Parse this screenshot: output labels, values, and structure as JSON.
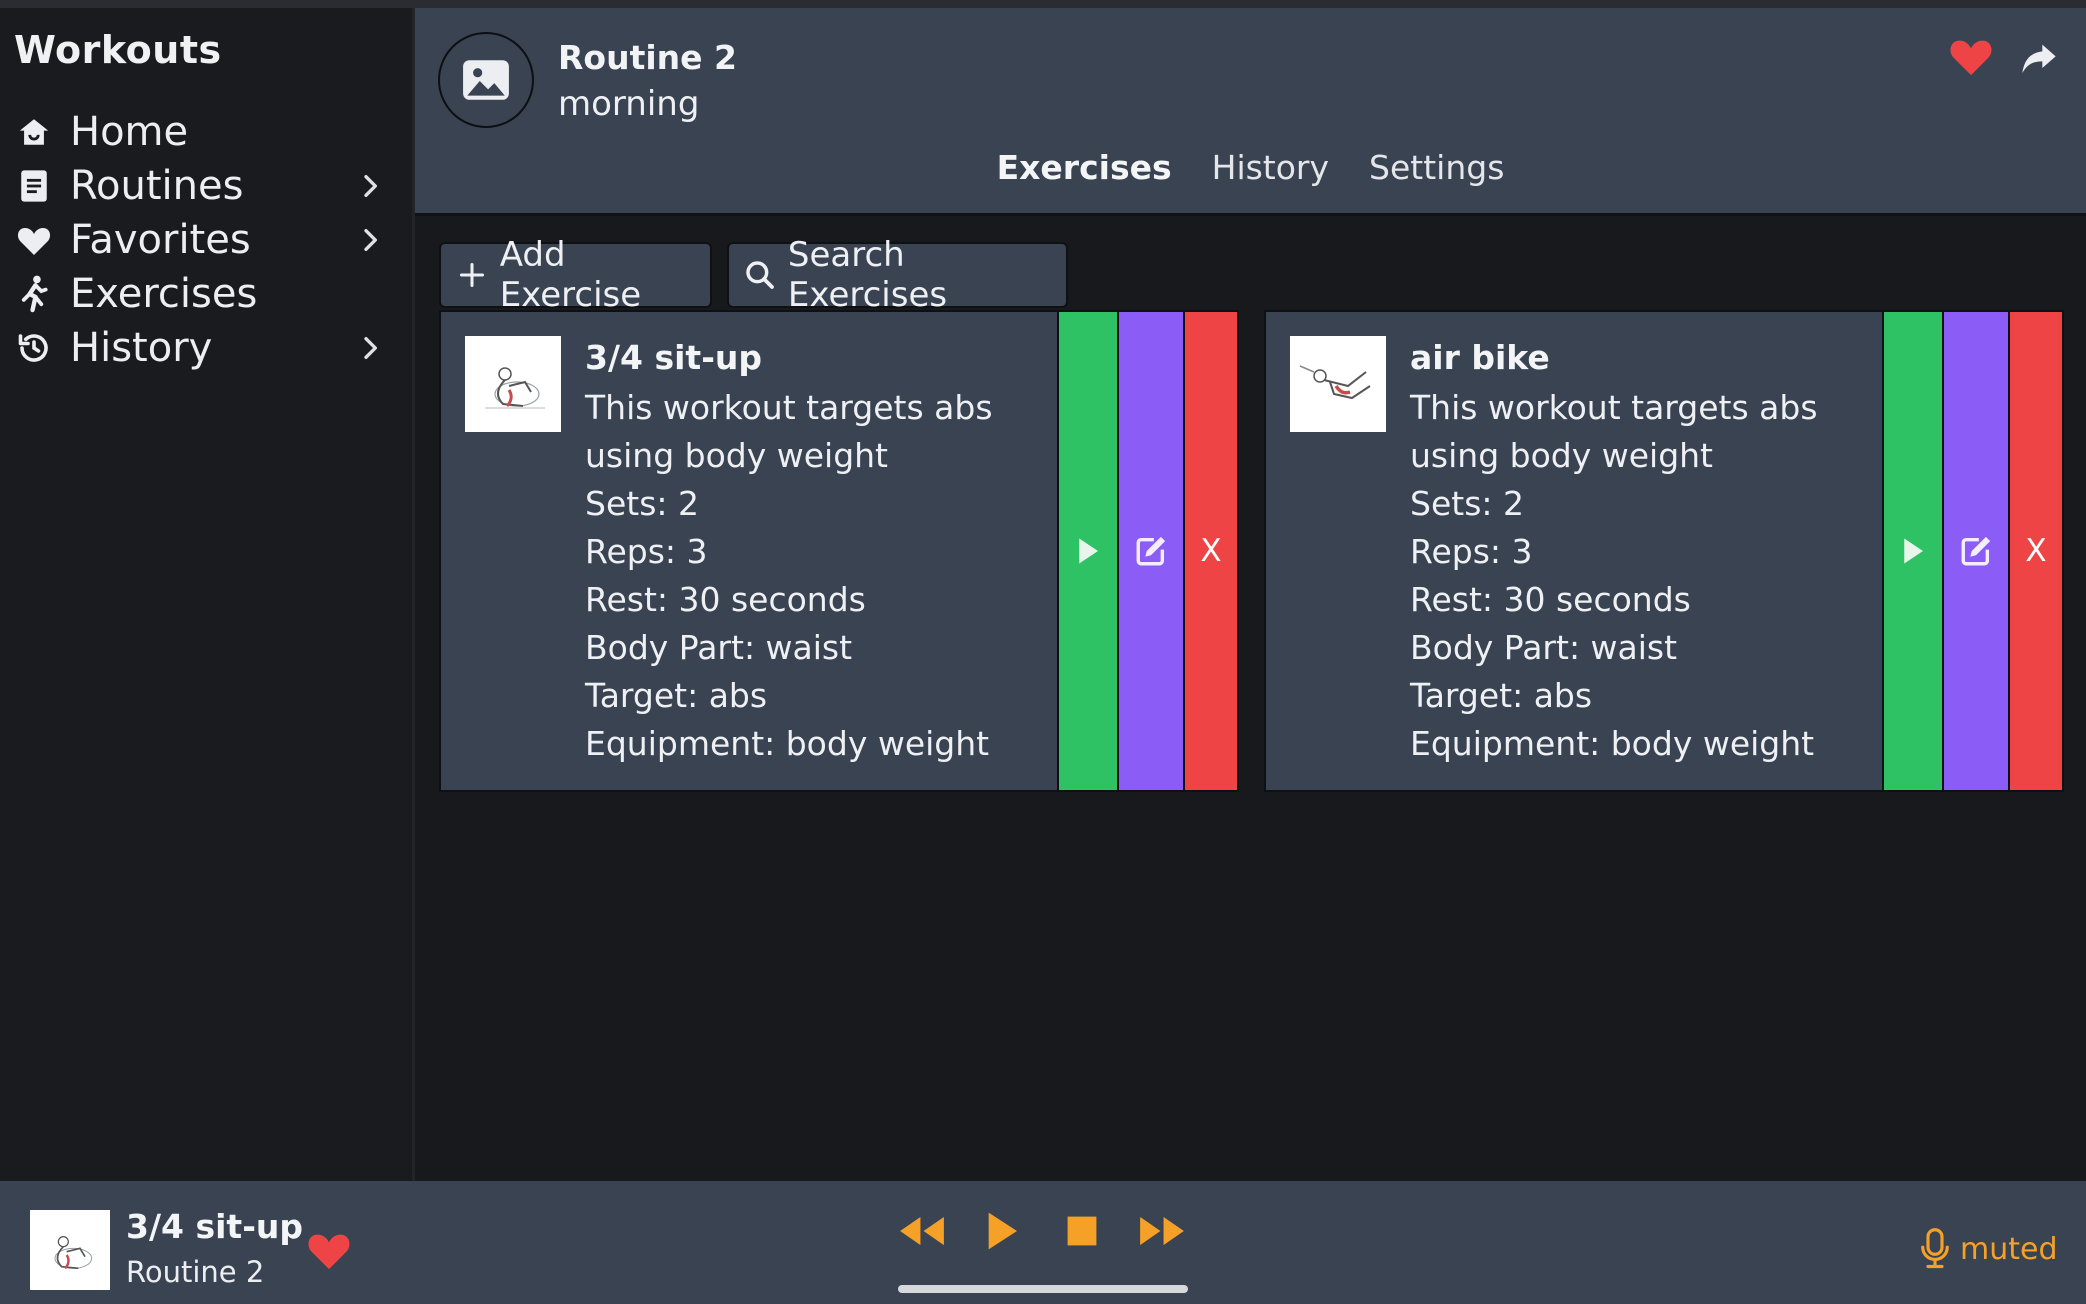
{
  "app": {
    "title": "Workouts"
  },
  "sidebar": {
    "items": [
      {
        "label": "Home",
        "icon": "home-icon",
        "has_submenu": false
      },
      {
        "label": "Routines",
        "icon": "document-icon",
        "has_submenu": true
      },
      {
        "label": "Favorites",
        "icon": "heart-icon",
        "has_submenu": true
      },
      {
        "label": "Exercises",
        "icon": "running-person-icon",
        "has_submenu": false
      },
      {
        "label": "History",
        "icon": "history-icon",
        "has_submenu": true
      }
    ]
  },
  "header": {
    "title": "Routine 2",
    "subtitle": "morning",
    "tabs": [
      {
        "label": "Exercises",
        "active": true
      },
      {
        "label": "History",
        "active": false
      },
      {
        "label": "Settings",
        "active": false
      }
    ],
    "favorited": true
  },
  "toolbar": {
    "add_label": "Add Exercise",
    "search_label": "Search Exercises"
  },
  "exercises": [
    {
      "name": "3/4 sit-up",
      "description_line1": "This workout targets abs",
      "description_line2": "using body weight",
      "sets": "Sets: 2",
      "reps": "Reps: 3",
      "rest": "Rest: 30 seconds",
      "body_part": "Body Part: waist",
      "target": "Target: abs",
      "equipment": "Equipment: body weight",
      "delete_label": "X"
    },
    {
      "name": "air bike",
      "description_line1": "This workout targets abs",
      "description_line2": "using body weight",
      "sets": "Sets: 2",
      "reps": "Reps: 3",
      "rest": "Rest: 30 seconds",
      "body_part": "Body Part: waist",
      "target": "Target: abs",
      "equipment": "Equipment: body weight",
      "delete_label": "X"
    }
  ],
  "player": {
    "title": "3/4 sit-up",
    "subtitle": "Routine 2",
    "favorited": true,
    "mic_status": "muted"
  },
  "colors": {
    "accent_orange": "#f5a127",
    "play_green": "#2ec265",
    "edit_purple": "#8b5cf6",
    "delete_red": "#ef4446",
    "heart_red": "#ef4446",
    "panel": "#394352",
    "background": "#18191c"
  }
}
